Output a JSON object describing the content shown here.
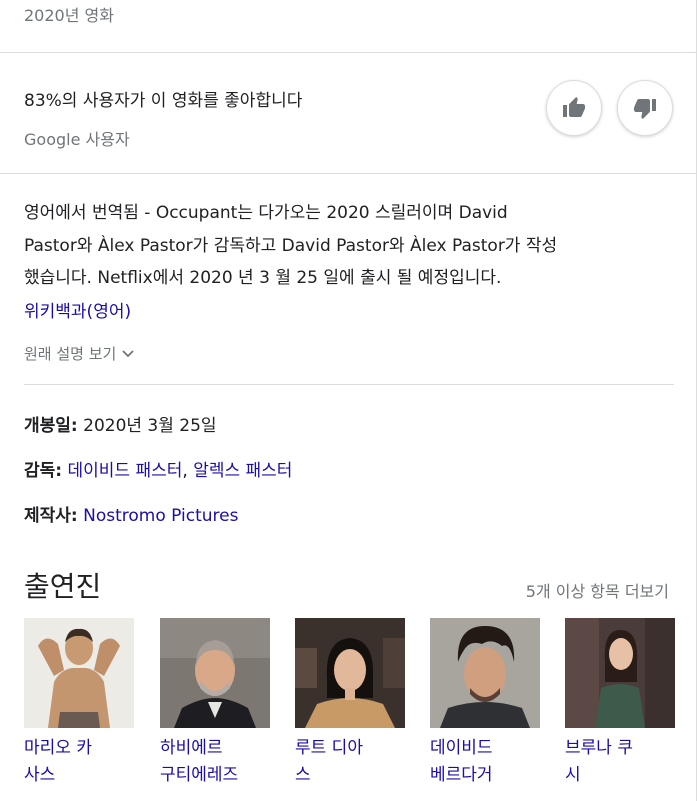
{
  "header": {
    "subtitle": "2020년 영화"
  },
  "rating": {
    "text": "83%의 사용자가 이 영화를 좋아합니다",
    "source": "Google 사용자",
    "thumb_up_icon": "thumb-up-icon",
    "thumb_down_icon": "thumb-down-icon"
  },
  "description": {
    "line1": "영어에서 번역됨 - Occupant는 다가오는 2020 스릴러이며 David",
    "line2": "Pastor와 Àlex Pastor가 감독하고 David Pastor와 Àlex Pastor가 작성",
    "line3": "했습니다. Netflix에서 2020 년 3 월 25 일에 출시 될 예정입니다.",
    "wiki_link": "위키백과(영어)",
    "show_original": "원래 설명 보기"
  },
  "facts": {
    "release_label": "개봉일:",
    "release_value": "2020년 3월 25일",
    "director_label": "감독:",
    "director_1": "데이비드 패스터",
    "director_sep": ", ",
    "director_2": "알렉스 패스터",
    "producer_label": "제작사:",
    "producer_value": "Nostromo Pictures"
  },
  "cast": {
    "title": "출연진",
    "more": "5개 이상 항목 더보기",
    "members": [
      {
        "line1": "마리오 카",
        "line2": "사스"
      },
      {
        "line1": "하비에르",
        "line2": "구티에레즈"
      },
      {
        "line1": "루트 디아",
        "line2": "스"
      },
      {
        "line1": "데이비드",
        "line2": "베르다거"
      },
      {
        "line1": "브루나 쿠",
        "line2": "시"
      }
    ]
  }
}
